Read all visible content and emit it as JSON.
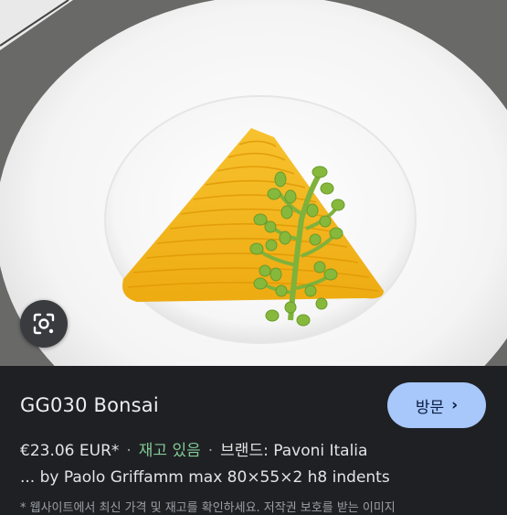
{
  "product": {
    "title": "GG030 Bonsai",
    "price": "€23.06 EUR*",
    "separator": "·",
    "stock": "재고 있음",
    "brand": "브랜드: Pavoni Italia",
    "description": "... by Paolo Griffamm max 80×55×2 h8 indents",
    "notice": "* 웹사이트에서 최신 가격 및 재고를 확인하세요. 저작권 보호를 받는 이미지"
  },
  "actions": {
    "visit_label": "방문",
    "visit_icon": "chevron-right-icon",
    "lens_icon": "google-lens-icon"
  },
  "colors": {
    "visit_button_bg": "#a8c7fa",
    "stock_text": "#81c995",
    "panel_bg": "#1f2024"
  }
}
